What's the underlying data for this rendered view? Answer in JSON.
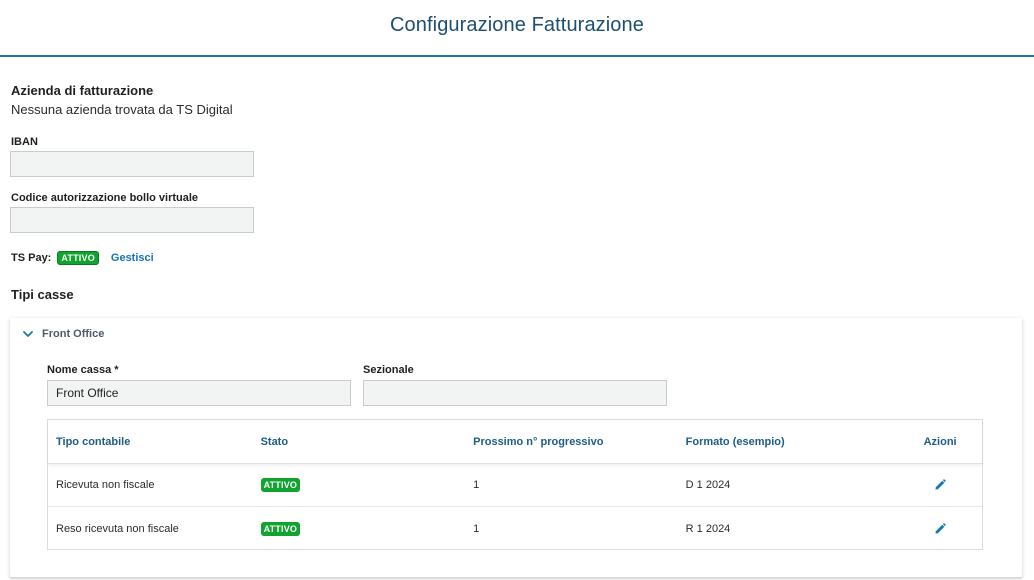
{
  "header": {
    "title": "Configurazione Fatturazione"
  },
  "company": {
    "title": "Azienda di fatturazione",
    "message": "Nessuna azienda trovata da TS Digital"
  },
  "fields": {
    "iban": {
      "label": "IBAN",
      "value": ""
    },
    "bollo": {
      "label": "Codice autorizzazione bollo virtuale",
      "value": ""
    }
  },
  "tspay": {
    "label": "TS Pay:",
    "status": "ATTIVO",
    "manage_label": "Gestisci"
  },
  "cash_types": {
    "title": "Tipi casse",
    "accordion": {
      "title": "Front Office",
      "name_label": "Nome cassa *",
      "name_value": "Front Office",
      "sectional_label": "Sezionale",
      "sectional_value": "",
      "table": {
        "headers": [
          "Tipo contabile",
          "Stato",
          "Prossimo n° progressivo",
          "Formato (esempio)",
          "Azioni"
        ],
        "rows": [
          {
            "type": "Ricevuta non fiscale",
            "status": "ATTIVO",
            "next": "1",
            "format": "D 1 2024"
          },
          {
            "type": "Reso ricevuta non fiscale",
            "status": "ATTIVO",
            "next": "1",
            "format": "R 1 2024"
          }
        ]
      }
    }
  },
  "colors": {
    "accent": "#1d7aa8",
    "title": "#1e4f72",
    "success": "#11a32f",
    "link": "#1576b7"
  },
  "icons": {
    "accordion": "chevron-down-icon",
    "edit": "pencil-icon"
  }
}
